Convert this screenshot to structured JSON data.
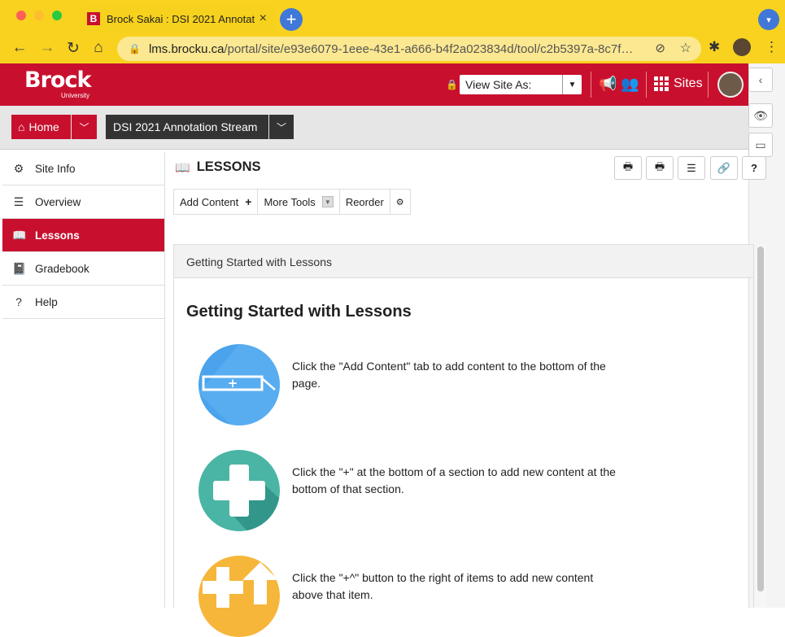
{
  "browser": {
    "tab_title": "Brock Sakai : DSI 2021 Annotat",
    "tab_favicon": "B",
    "tab_close": "×",
    "new_tab": "+",
    "url_host": "lms.brocku.ca",
    "url_path": "/portal/site/e93e6079-1eee-43e1-a666-b4f2a023834d/tool/c2b5397a-8c7f…",
    "accent": "#f8d21f"
  },
  "header": {
    "logo": "Brock",
    "logo_sub": "University",
    "view_site_as": "View Site As:",
    "sites_label": "Sites",
    "brand_color": "#c8102e"
  },
  "sitenav": {
    "home_label": "Home",
    "site_label": "DSI 2021 Annotation Stream"
  },
  "tools": [
    {
      "label": "Site Info",
      "icon": "gear-icon",
      "active": false
    },
    {
      "label": "Overview",
      "icon": "list-icon",
      "active": false
    },
    {
      "label": "Lessons",
      "icon": "book-open-icon",
      "active": true
    },
    {
      "label": "Gradebook",
      "icon": "gradebook-icon",
      "active": false
    },
    {
      "label": "Help",
      "icon": "help-icon",
      "active": false
    }
  ],
  "main": {
    "title": "LESSONS",
    "toolbar": {
      "add_content": "Add Content",
      "add_icon": "+",
      "more_tools": "More Tools",
      "reorder": "Reorder"
    },
    "panel_header": "Getting Started with Lessons",
    "heading": "Getting Started with Lessons",
    "steps": [
      "Click the \"Add Content\" tab to add content to the bottom of the page.",
      "Click the \"+\" at the bottom of a section to add new content at the bottom of that section.",
      "Click the \"+^\" button to the right of items to add new content above that item."
    ]
  },
  "rail": {
    "help_label": "?"
  }
}
